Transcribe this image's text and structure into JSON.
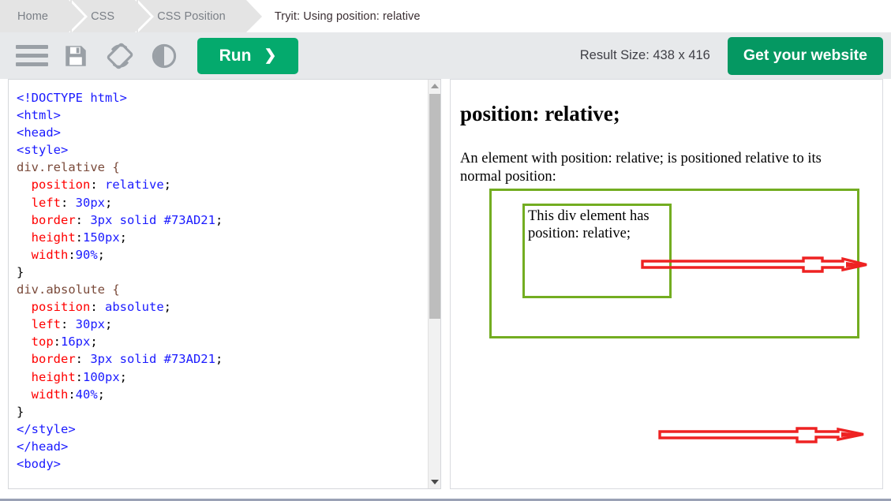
{
  "breadcrumb": {
    "items": [
      {
        "label": "Home",
        "current": false
      },
      {
        "label": "CSS",
        "current": false
      },
      {
        "label": "CSS Position",
        "current": false
      },
      {
        "label": "Tryit: Using position: relative",
        "current": true
      }
    ]
  },
  "toolbar": {
    "menu_icon": "hamburger-menu-icon",
    "save_icon": "floppy-disk-save-icon",
    "orientation_icon": "rotate-layout-icon",
    "theme_icon": "dark-mode-contrast-icon",
    "run_label": "Run",
    "run_chevron": "❯",
    "result_size_label": "Result Size: 438 x 416",
    "get_website_label": "Get your website"
  },
  "editor": {
    "code_lines": [
      {
        "segments": [
          {
            "t": "<!DOCTYPE html>",
            "c": "tag"
          }
        ]
      },
      {
        "segments": [
          {
            "t": "<html>",
            "c": "tag"
          }
        ]
      },
      {
        "segments": [
          {
            "t": "<head>",
            "c": "tag"
          }
        ]
      },
      {
        "segments": [
          {
            "t": "<style>",
            "c": "tag"
          }
        ]
      },
      {
        "segments": [
          {
            "t": "div.relative {",
            "c": "sel"
          }
        ]
      },
      {
        "segments": [
          {
            "t": "  position",
            "c": "prop"
          },
          {
            "t": ": ",
            "c": "punc"
          },
          {
            "t": "relative",
            "c": "val"
          },
          {
            "t": ";",
            "c": "punc"
          }
        ]
      },
      {
        "segments": [
          {
            "t": "  left",
            "c": "prop"
          },
          {
            "t": ": ",
            "c": "punc"
          },
          {
            "t": "30px",
            "c": "val"
          },
          {
            "t": ";",
            "c": "punc"
          }
        ]
      },
      {
        "segments": [
          {
            "t": "  border",
            "c": "prop"
          },
          {
            "t": ": ",
            "c": "punc"
          },
          {
            "t": "3px solid #73AD21",
            "c": "val"
          },
          {
            "t": ";",
            "c": "punc"
          }
        ]
      },
      {
        "segments": [
          {
            "t": "  height",
            "c": "prop"
          },
          {
            "t": ":",
            "c": "punc"
          },
          {
            "t": "150px",
            "c": "val"
          },
          {
            "t": ";",
            "c": "punc"
          }
        ]
      },
      {
        "segments": [
          {
            "t": "  width",
            "c": "prop"
          },
          {
            "t": ":",
            "c": "punc"
          },
          {
            "t": "90%",
            "c": "val"
          },
          {
            "t": ";",
            "c": "punc"
          }
        ]
      },
      {
        "segments": [
          {
            "t": "}",
            "c": "punc"
          }
        ]
      },
      {
        "segments": [
          {
            "t": "div.absolute {",
            "c": "sel"
          }
        ]
      },
      {
        "segments": [
          {
            "t": "  position",
            "c": "prop"
          },
          {
            "t": ": ",
            "c": "punc"
          },
          {
            "t": "absolute",
            "c": "val"
          },
          {
            "t": ";",
            "c": "punc"
          }
        ]
      },
      {
        "segments": [
          {
            "t": "  left",
            "c": "prop"
          },
          {
            "t": ": ",
            "c": "punc"
          },
          {
            "t": "30px",
            "c": "val"
          },
          {
            "t": ";",
            "c": "punc"
          }
        ]
      },
      {
        "segments": [
          {
            "t": "  top",
            "c": "prop"
          },
          {
            "t": ":",
            "c": "punc"
          },
          {
            "t": "16px",
            "c": "val"
          },
          {
            "t": ";",
            "c": "punc"
          }
        ]
      },
      {
        "segments": [
          {
            "t": "  border",
            "c": "prop"
          },
          {
            "t": ": ",
            "c": "punc"
          },
          {
            "t": "3px solid #73AD21",
            "c": "val"
          },
          {
            "t": ";",
            "c": "punc"
          }
        ]
      },
      {
        "segments": [
          {
            "t": "  height",
            "c": "prop"
          },
          {
            "t": ":",
            "c": "punc"
          },
          {
            "t": "100px",
            "c": "val"
          },
          {
            "t": ";",
            "c": "punc"
          }
        ]
      },
      {
        "segments": [
          {
            "t": "  width",
            "c": "prop"
          },
          {
            "t": ":",
            "c": "punc"
          },
          {
            "t": "40%",
            "c": "val"
          },
          {
            "t": ";",
            "c": "punc"
          }
        ]
      },
      {
        "segments": [
          {
            "t": "}",
            "c": "punc"
          }
        ]
      },
      {
        "segments": [
          {
            "t": "</style>",
            "c": "tag"
          }
        ]
      },
      {
        "segments": [
          {
            "t": "</head>",
            "c": "tag"
          }
        ]
      },
      {
        "segments": [
          {
            "t": "<body>",
            "c": "tag"
          }
        ]
      }
    ],
    "scrollbar": {
      "up_arrow": "scroll-up-arrow",
      "down_arrow": "scroll-down-arrow"
    }
  },
  "result": {
    "heading": "position: relative;",
    "paragraph": "An element with position: relative; is positioned relative to its normal position:",
    "inner_box_text": "This div element has position: relative;",
    "box_border_color": "#73AD21"
  },
  "annotations": {
    "color": "#ee2222",
    "arrows": [
      {
        "name": "annotation-arrow-top",
        "direction": "right"
      },
      {
        "name": "annotation-arrow-bottom",
        "direction": "right"
      }
    ]
  }
}
